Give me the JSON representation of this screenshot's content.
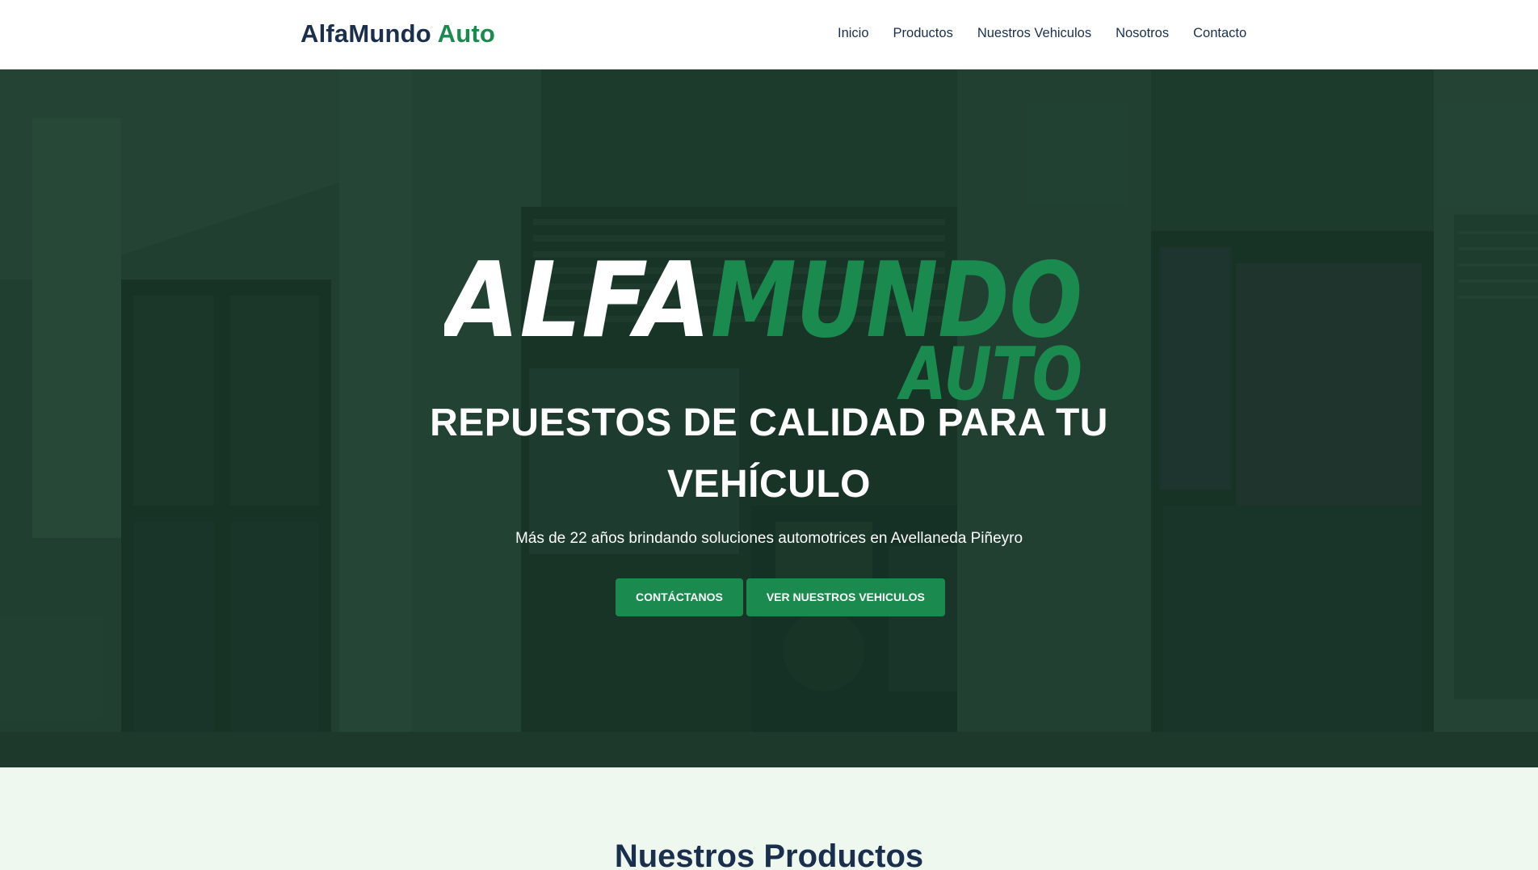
{
  "navbar": {
    "brand_primary": "AlfaMundo",
    "brand_accent": "Auto",
    "links": [
      {
        "label": "Inicio"
      },
      {
        "label": "Productos"
      },
      {
        "label": "Nuestros Vehiculos"
      },
      {
        "label": "Nosotros"
      },
      {
        "label": "Contacto"
      }
    ]
  },
  "hero": {
    "logo_line1_a": "ALFA",
    "logo_line1_b": "MUNDO",
    "logo_line2": "AUTO",
    "heading_line1": "REPUESTOS DE CALIDAD PARA TU",
    "heading_line2": "VEHÍCULO",
    "subtitle": "Más de 22 años brindando soluciones automotrices en Avellaneda Piñeyro",
    "buttons": {
      "contact": "CONTÁCTANOS",
      "vehicles": "VER NUESTROS VEHICULOS"
    }
  },
  "products": {
    "title": "Nuestros Productos"
  },
  "colors": {
    "navy": "#1a2f4e",
    "green": "#1b8a4f",
    "light_green_bg": "#eef8ee",
    "white": "#ffffff"
  }
}
